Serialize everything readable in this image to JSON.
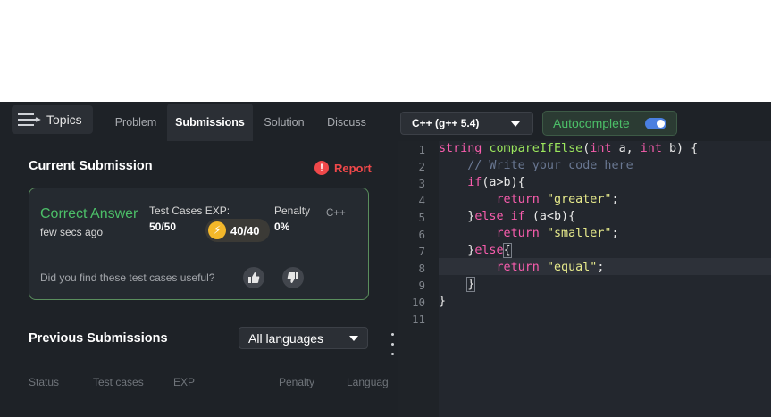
{
  "left": {
    "topics_label": "Topics",
    "tabs": [
      {
        "label": "Problem"
      },
      {
        "label": "Submissions"
      },
      {
        "label": "Solution"
      },
      {
        "label": "Discuss"
      }
    ],
    "current_title": "Current Submission",
    "report_label": "Report",
    "submission": {
      "verdict": "Correct Answer",
      "time_ago": "few secs ago",
      "test_cases_label": "Test Cases",
      "exp_label": "EXP:",
      "test_cases_value": "50/50",
      "exp_value": "40/40",
      "penalty_label": "Penalty",
      "penalty_value": "0%",
      "language": "C++",
      "feedback_question": "Did you find these test cases useful?"
    },
    "previous_title": "Previous Submissions",
    "language_filter": "All languages",
    "columns": [
      "Status",
      "Test cases",
      "EXP",
      "Penalty",
      "Language"
    ]
  },
  "editor": {
    "compiler": "C++ (g++ 5.4)",
    "autocomplete_label": "Autocomplete",
    "autocomplete_on": true,
    "line_numbers": [
      "1",
      "2",
      "3",
      "4",
      "5",
      "6",
      "7",
      "8",
      "9",
      "10",
      "11"
    ],
    "colors": {
      "keyword": "#f85dad",
      "function": "#9be65d",
      "comment": "#6a7893",
      "string": "#e6e98b",
      "verdict": "#4cbf68",
      "report": "#f0484a"
    }
  }
}
